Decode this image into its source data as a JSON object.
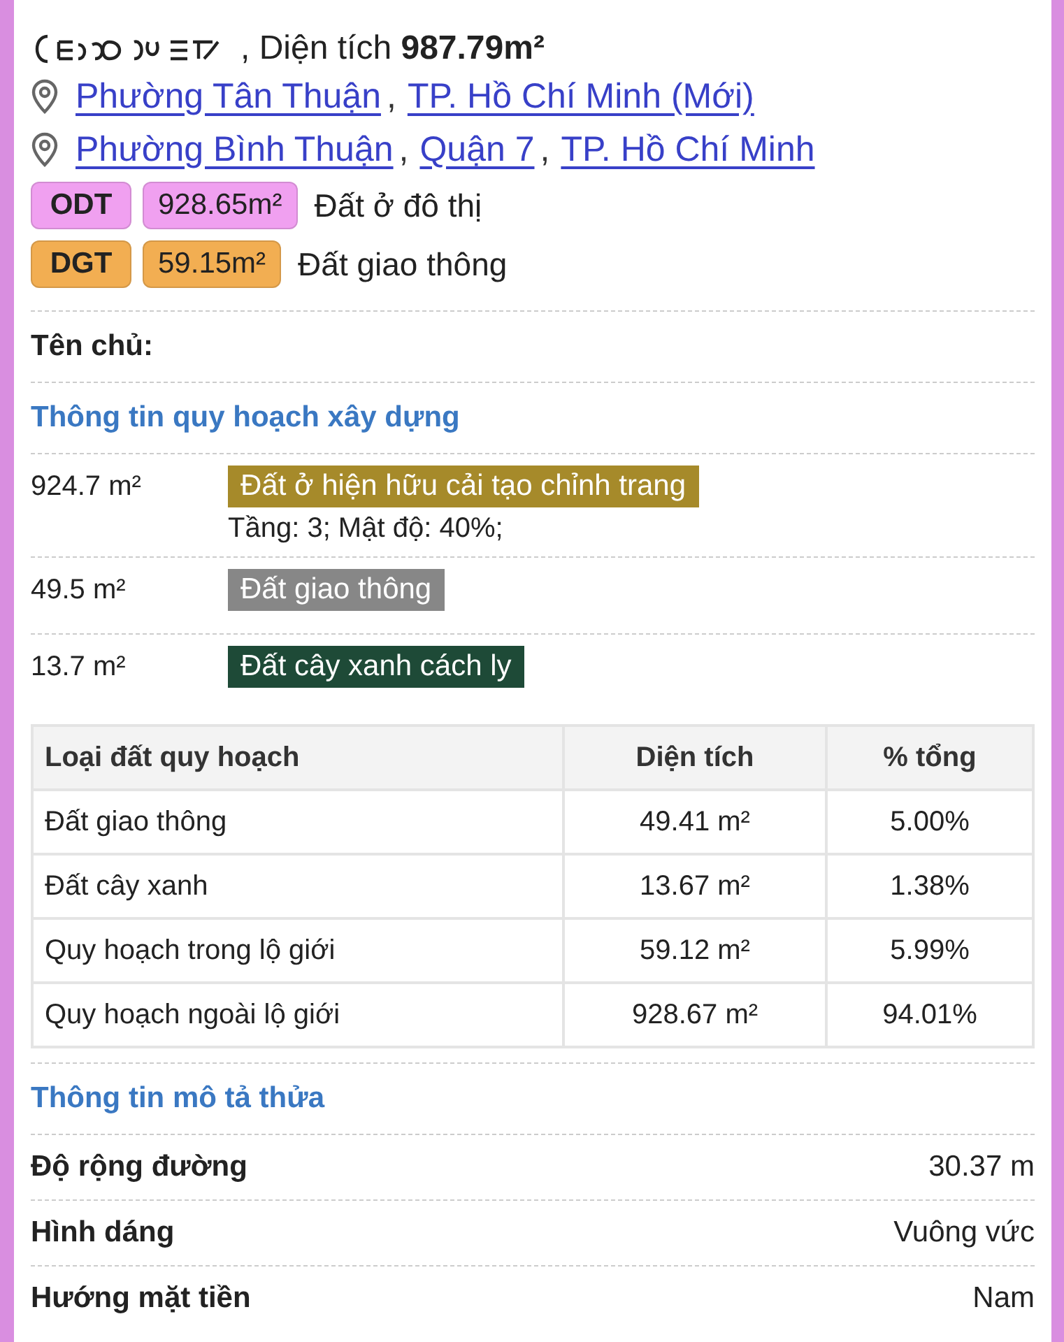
{
  "title": {
    "area_label": ", Diện tích",
    "area_value": "987.79m²"
  },
  "addresses": [
    {
      "separator": ",",
      "parts": [
        "Phường Tân Thuận",
        "TP. Hồ Chí Minh (Mới)"
      ]
    },
    {
      "separator": ",",
      "parts": [
        "Phường Bình Thuận",
        "Quận 7",
        "TP. Hồ Chí Minh"
      ]
    }
  ],
  "land_types": [
    {
      "code": "ODT",
      "area": "928.65m²",
      "name": "Đất ở đô thị",
      "color": "#f0a0f0"
    },
    {
      "code": "DGT",
      "area": "59.15m²",
      "name": "Đất giao thông",
      "color": "#f2ae52"
    }
  ],
  "owner": {
    "label": "Tên chủ:"
  },
  "planning": {
    "title": "Thông tin quy hoạch xây dựng",
    "items": [
      {
        "area": "924.7 m²",
        "zone": "Đất ở hiện hữu cải tạo chỉnh trang",
        "color": "#a68a2a",
        "note": "Tầng: 3; Mật độ: 40%;"
      },
      {
        "area": "49.5 m²",
        "zone": "Đất giao thông",
        "color": "#878787"
      },
      {
        "area": "13.7 m²",
        "zone": "Đất cây xanh cách ly",
        "color": "#1e4a37"
      }
    ]
  },
  "table": {
    "columns": [
      "Loại đất quy hoạch",
      "Diện tích",
      "% tổng"
    ],
    "rows": [
      [
        "Đất giao thông",
        "49.41 m²",
        "5.00%"
      ],
      [
        "Đất cây xanh",
        "13.67 m²",
        "1.38%"
      ],
      [
        "Quy hoạch trong lộ giới",
        "59.12 m²",
        "5.99%"
      ],
      [
        "Quy hoạch ngoài lộ giới",
        "928.67 m²",
        "94.01%"
      ]
    ]
  },
  "description": {
    "title": "Thông tin mô tả thửa",
    "rows": [
      {
        "label": "Độ rộng đường",
        "value": "30.37 m"
      },
      {
        "label": "Hình dáng",
        "value": "Vuông vức"
      },
      {
        "label": "Hướng mặt tiền",
        "value": "Nam"
      }
    ]
  }
}
